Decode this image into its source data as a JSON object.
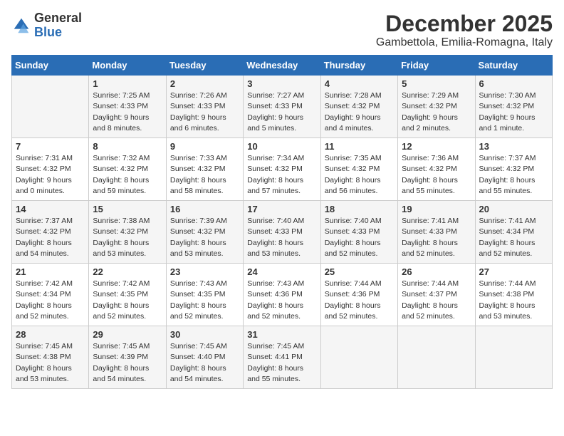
{
  "logo": {
    "general": "General",
    "blue": "Blue"
  },
  "header": {
    "month_year": "December 2025",
    "location": "Gambettola, Emilia-Romagna, Italy"
  },
  "weekdays": [
    "Sunday",
    "Monday",
    "Tuesday",
    "Wednesday",
    "Thursday",
    "Friday",
    "Saturday"
  ],
  "weeks": [
    [
      {
        "day": "",
        "sunrise": "",
        "sunset": "",
        "daylight": ""
      },
      {
        "day": "1",
        "sunrise": "Sunrise: 7:25 AM",
        "sunset": "Sunset: 4:33 PM",
        "daylight": "Daylight: 9 hours and 8 minutes."
      },
      {
        "day": "2",
        "sunrise": "Sunrise: 7:26 AM",
        "sunset": "Sunset: 4:33 PM",
        "daylight": "Daylight: 9 hours and 6 minutes."
      },
      {
        "day": "3",
        "sunrise": "Sunrise: 7:27 AM",
        "sunset": "Sunset: 4:33 PM",
        "daylight": "Daylight: 9 hours and 5 minutes."
      },
      {
        "day": "4",
        "sunrise": "Sunrise: 7:28 AM",
        "sunset": "Sunset: 4:32 PM",
        "daylight": "Daylight: 9 hours and 4 minutes."
      },
      {
        "day": "5",
        "sunrise": "Sunrise: 7:29 AM",
        "sunset": "Sunset: 4:32 PM",
        "daylight": "Daylight: 9 hours and 2 minutes."
      },
      {
        "day": "6",
        "sunrise": "Sunrise: 7:30 AM",
        "sunset": "Sunset: 4:32 PM",
        "daylight": "Daylight: 9 hours and 1 minute."
      }
    ],
    [
      {
        "day": "7",
        "sunrise": "Sunrise: 7:31 AM",
        "sunset": "Sunset: 4:32 PM",
        "daylight": "Daylight: 9 hours and 0 minutes."
      },
      {
        "day": "8",
        "sunrise": "Sunrise: 7:32 AM",
        "sunset": "Sunset: 4:32 PM",
        "daylight": "Daylight: 8 hours and 59 minutes."
      },
      {
        "day": "9",
        "sunrise": "Sunrise: 7:33 AM",
        "sunset": "Sunset: 4:32 PM",
        "daylight": "Daylight: 8 hours and 58 minutes."
      },
      {
        "day": "10",
        "sunrise": "Sunrise: 7:34 AM",
        "sunset": "Sunset: 4:32 PM",
        "daylight": "Daylight: 8 hours and 57 minutes."
      },
      {
        "day": "11",
        "sunrise": "Sunrise: 7:35 AM",
        "sunset": "Sunset: 4:32 PM",
        "daylight": "Daylight: 8 hours and 56 minutes."
      },
      {
        "day": "12",
        "sunrise": "Sunrise: 7:36 AM",
        "sunset": "Sunset: 4:32 PM",
        "daylight": "Daylight: 8 hours and 55 minutes."
      },
      {
        "day": "13",
        "sunrise": "Sunrise: 7:37 AM",
        "sunset": "Sunset: 4:32 PM",
        "daylight": "Daylight: 8 hours and 55 minutes."
      }
    ],
    [
      {
        "day": "14",
        "sunrise": "Sunrise: 7:37 AM",
        "sunset": "Sunset: 4:32 PM",
        "daylight": "Daylight: 8 hours and 54 minutes."
      },
      {
        "day": "15",
        "sunrise": "Sunrise: 7:38 AM",
        "sunset": "Sunset: 4:32 PM",
        "daylight": "Daylight: 8 hours and 53 minutes."
      },
      {
        "day": "16",
        "sunrise": "Sunrise: 7:39 AM",
        "sunset": "Sunset: 4:32 PM",
        "daylight": "Daylight: 8 hours and 53 minutes."
      },
      {
        "day": "17",
        "sunrise": "Sunrise: 7:40 AM",
        "sunset": "Sunset: 4:33 PM",
        "daylight": "Daylight: 8 hours and 53 minutes."
      },
      {
        "day": "18",
        "sunrise": "Sunrise: 7:40 AM",
        "sunset": "Sunset: 4:33 PM",
        "daylight": "Daylight: 8 hours and 52 minutes."
      },
      {
        "day": "19",
        "sunrise": "Sunrise: 7:41 AM",
        "sunset": "Sunset: 4:33 PM",
        "daylight": "Daylight: 8 hours and 52 minutes."
      },
      {
        "day": "20",
        "sunrise": "Sunrise: 7:41 AM",
        "sunset": "Sunset: 4:34 PM",
        "daylight": "Daylight: 8 hours and 52 minutes."
      }
    ],
    [
      {
        "day": "21",
        "sunrise": "Sunrise: 7:42 AM",
        "sunset": "Sunset: 4:34 PM",
        "daylight": "Daylight: 8 hours and 52 minutes."
      },
      {
        "day": "22",
        "sunrise": "Sunrise: 7:42 AM",
        "sunset": "Sunset: 4:35 PM",
        "daylight": "Daylight: 8 hours and 52 minutes."
      },
      {
        "day": "23",
        "sunrise": "Sunrise: 7:43 AM",
        "sunset": "Sunset: 4:35 PM",
        "daylight": "Daylight: 8 hours and 52 minutes."
      },
      {
        "day": "24",
        "sunrise": "Sunrise: 7:43 AM",
        "sunset": "Sunset: 4:36 PM",
        "daylight": "Daylight: 8 hours and 52 minutes."
      },
      {
        "day": "25",
        "sunrise": "Sunrise: 7:44 AM",
        "sunset": "Sunset: 4:36 PM",
        "daylight": "Daylight: 8 hours and 52 minutes."
      },
      {
        "day": "26",
        "sunrise": "Sunrise: 7:44 AM",
        "sunset": "Sunset: 4:37 PM",
        "daylight": "Daylight: 8 hours and 52 minutes."
      },
      {
        "day": "27",
        "sunrise": "Sunrise: 7:44 AM",
        "sunset": "Sunset: 4:38 PM",
        "daylight": "Daylight: 8 hours and 53 minutes."
      }
    ],
    [
      {
        "day": "28",
        "sunrise": "Sunrise: 7:45 AM",
        "sunset": "Sunset: 4:38 PM",
        "daylight": "Daylight: 8 hours and 53 minutes."
      },
      {
        "day": "29",
        "sunrise": "Sunrise: 7:45 AM",
        "sunset": "Sunset: 4:39 PM",
        "daylight": "Daylight: 8 hours and 54 minutes."
      },
      {
        "day": "30",
        "sunrise": "Sunrise: 7:45 AM",
        "sunset": "Sunset: 4:40 PM",
        "daylight": "Daylight: 8 hours and 54 minutes."
      },
      {
        "day": "31",
        "sunrise": "Sunrise: 7:45 AM",
        "sunset": "Sunset: 4:41 PM",
        "daylight": "Daylight: 8 hours and 55 minutes."
      },
      {
        "day": "",
        "sunrise": "",
        "sunset": "",
        "daylight": ""
      },
      {
        "day": "",
        "sunrise": "",
        "sunset": "",
        "daylight": ""
      },
      {
        "day": "",
        "sunrise": "",
        "sunset": "",
        "daylight": ""
      }
    ]
  ]
}
